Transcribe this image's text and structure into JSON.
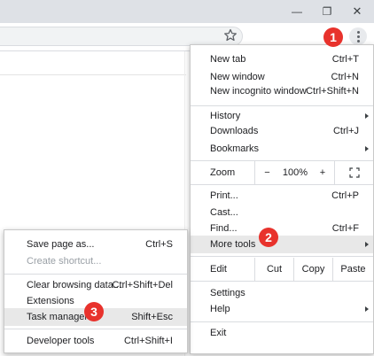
{
  "browser": {
    "window_controls": {
      "minimize": "—",
      "restore": "❐",
      "close": "✕"
    }
  },
  "main_menu": {
    "new_tab": {
      "label": "New tab",
      "shortcut": "Ctrl+T"
    },
    "new_window": {
      "label": "New window",
      "shortcut": "Ctrl+N"
    },
    "new_incognito": {
      "label": "New incognito window",
      "shortcut": "Ctrl+Shift+N"
    },
    "history": {
      "label": "History"
    },
    "downloads": {
      "label": "Downloads",
      "shortcut": "Ctrl+J"
    },
    "bookmarks": {
      "label": "Bookmarks"
    },
    "zoom": {
      "label": "Zoom",
      "minus": "−",
      "value": "100%",
      "plus": "+"
    },
    "print": {
      "label": "Print...",
      "shortcut": "Ctrl+P"
    },
    "cast": {
      "label": "Cast..."
    },
    "find": {
      "label": "Find...",
      "shortcut": "Ctrl+F"
    },
    "more_tools": {
      "label": "More tools"
    },
    "edit": {
      "label": "Edit",
      "cut": "Cut",
      "copy": "Copy",
      "paste": "Paste"
    },
    "settings": {
      "label": "Settings"
    },
    "help": {
      "label": "Help"
    },
    "exit": {
      "label": "Exit"
    }
  },
  "more_tools_menu": {
    "save_page": {
      "label": "Save page as...",
      "shortcut": "Ctrl+S"
    },
    "create_shortcut": {
      "label": "Create shortcut..."
    },
    "clear_browsing": {
      "label": "Clear browsing data...",
      "shortcut": "Ctrl+Shift+Del"
    },
    "extensions": {
      "label": "Extensions"
    },
    "task_manager": {
      "label": "Task manager",
      "shortcut": "Shift+Esc"
    },
    "developer_tools": {
      "label": "Developer tools",
      "shortcut": "Ctrl+Shift+I"
    }
  },
  "annotations": {
    "step1": "1",
    "step2": "2",
    "step3": "3"
  },
  "colors": {
    "badge": "#e8322c",
    "highlight": "#e8e8e8",
    "titlebar": "#dee1e6"
  }
}
